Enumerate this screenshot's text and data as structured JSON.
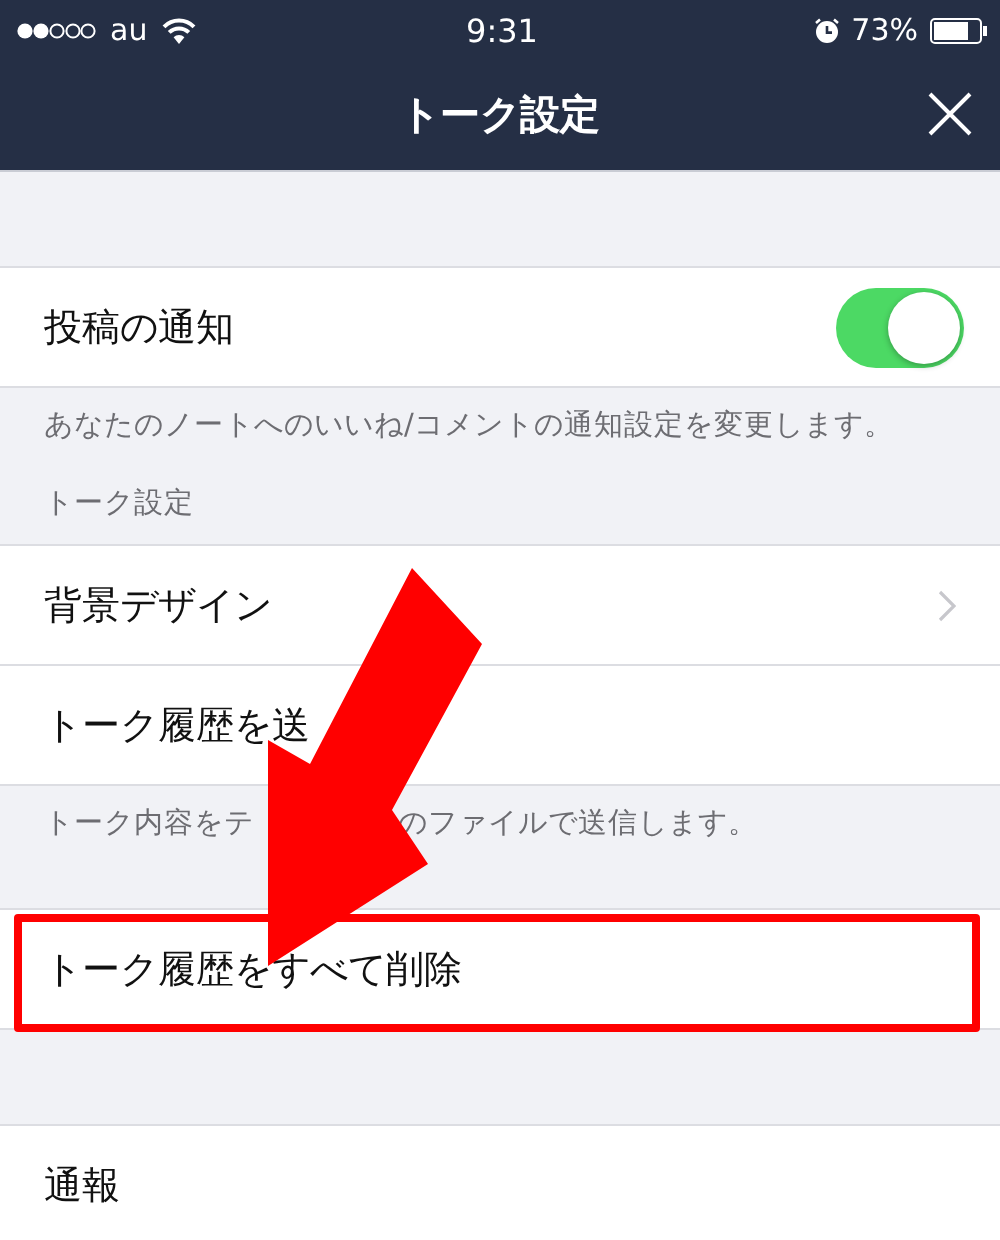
{
  "status_bar": {
    "carrier": "au",
    "time": "9:31",
    "battery": "73%"
  },
  "nav": {
    "title": "トーク設定"
  },
  "groups": [
    {
      "rows": [
        {
          "kind": "toggle",
          "label": "投稿の通知",
          "on": true
        }
      ],
      "note": [
        "あなたのノートへのいいね/コメントの通知設定を変更します。"
      ]
    },
    {
      "header": "トーク設定",
      "rows": [
        {
          "kind": "link",
          "label": "背景デザイン"
        },
        {
          "kind": "plain",
          "label": "トーク履歴を送"
        }
      ],
      "note": [
        "トーク内容をテ",
        "のファイルで送信します。"
      ]
    },
    {
      "rows": [
        {
          "kind": "plain",
          "label": "トーク履歴をすべて削除",
          "highlighted": true
        }
      ]
    },
    {
      "rows": [
        {
          "kind": "plain",
          "label": "通報"
        }
      ]
    }
  ],
  "annotation": {
    "kind": "arrow"
  }
}
